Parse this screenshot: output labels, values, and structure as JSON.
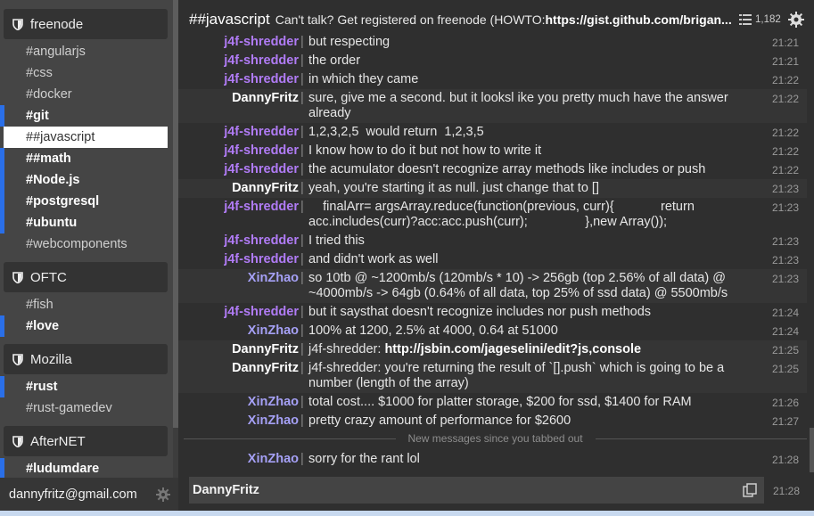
{
  "sidebar": {
    "groups": [
      {
        "network": "freenode",
        "channels": [
          {
            "name": "#angularjs",
            "unread": false,
            "active": false
          },
          {
            "name": "#css",
            "unread": false,
            "active": false
          },
          {
            "name": "#docker",
            "unread": false,
            "active": false
          },
          {
            "name": "#git",
            "unread": true,
            "active": false
          },
          {
            "name": "##javascript",
            "unread": false,
            "active": true
          },
          {
            "name": "##math",
            "unread": true,
            "active": false
          },
          {
            "name": "#Node.js",
            "unread": true,
            "active": false
          },
          {
            "name": "#postgresql",
            "unread": true,
            "active": false
          },
          {
            "name": "#ubuntu",
            "unread": true,
            "active": false
          },
          {
            "name": "#webcomponents",
            "unread": false,
            "active": false
          }
        ]
      },
      {
        "network": "OFTC",
        "channels": [
          {
            "name": "#fish",
            "unread": false,
            "active": false
          },
          {
            "name": "#love",
            "unread": true,
            "active": false
          }
        ]
      },
      {
        "network": "Mozilla",
        "channels": [
          {
            "name": "#rust",
            "unread": true,
            "active": false
          },
          {
            "name": "#rust-gamedev",
            "unread": false,
            "active": false
          }
        ]
      },
      {
        "network": "AfterNET",
        "channels": [
          {
            "name": "#ludumdare",
            "unread": true,
            "active": false
          }
        ]
      }
    ],
    "user_email": "dannyfritz@gmail.com",
    "unread_color": "#2a6fe8"
  },
  "header": {
    "channel": "##javascript",
    "topic": "Can't talk? Get registered on freenode (HOWTO: ",
    "topic_url": "https://gist.github.com/brigan...",
    "user_count": "1,182"
  },
  "messages": [
    {
      "nick": "j4f-shredder",
      "color": "purple",
      "text": "but respecting",
      "time": "21:21",
      "alt": false
    },
    {
      "nick": "j4f-shredder",
      "color": "purple",
      "text": "the order",
      "time": "21:21",
      "alt": false
    },
    {
      "nick": "j4f-shredder",
      "color": "purple",
      "text": "in which they came",
      "time": "21:22",
      "alt": false
    },
    {
      "nick": "DannyFritz",
      "color": "white",
      "text": "sure, give me a second. but it looksl ike you pretty much have the answer already",
      "time": "21:22",
      "alt": true
    },
    {
      "nick": "j4f-shredder",
      "color": "purple",
      "text": "1,2,3,2,5  would return  1,2,3,5",
      "time": "21:22",
      "alt": false
    },
    {
      "nick": "j4f-shredder",
      "color": "purple",
      "text": "I know how to do it but not how to write it",
      "time": "21:22",
      "alt": false
    },
    {
      "nick": "j4f-shredder",
      "color": "purple",
      "text": "the acumulator doesn't recognize array methods like includes or push",
      "time": "21:22",
      "alt": false
    },
    {
      "nick": "DannyFritz",
      "color": "white",
      "text": "yeah, you're starting it as null. just change that to []",
      "time": "21:23",
      "alt": true
    },
    {
      "nick": "j4f-shredder",
      "color": "purple",
      "text": "    finalArr= argsArray.reduce(function(previous, curr){             return acc.includes(curr)?acc:acc.push(curr);                },new Array());",
      "time": "21:23",
      "alt": false
    },
    {
      "nick": "j4f-shredder",
      "color": "purple",
      "text": "I tried this",
      "time": "21:23",
      "alt": false
    },
    {
      "nick": "j4f-shredder",
      "color": "purple",
      "text": "and didn't work as well",
      "time": "21:23",
      "alt": false
    },
    {
      "nick": "XinZhao",
      "color": "lav",
      "text": "so 10tb @ ~1200mb/s (120mb/s * 10) -> 256gb (top 2.56% of all data) @ ~4000mb/s -> 64gb (0.64% of all data, top 25% of ssd data) @ 5500mb/s",
      "time": "21:23",
      "alt": true
    },
    {
      "nick": "j4f-shredder",
      "color": "purple",
      "text": "but it saysthat doesn't recognize includes nor push methods",
      "time": "21:24",
      "alt": false
    },
    {
      "nick": "XinZhao",
      "color": "lav",
      "text": "100% at 1200, 2.5% at 4000, 0.64 at 51000",
      "time": "21:24",
      "alt": false
    },
    {
      "nick": "DannyFritz",
      "color": "white",
      "text": "j4f-shredder: ",
      "link": "http://jsbin.com/jageselini/edit?js,console",
      "time": "21:25",
      "alt": true
    },
    {
      "nick": "DannyFritz",
      "color": "white",
      "text": "j4f-shredder: you're returning the result of `[].push` which is going to be a number (length of the array)",
      "time": "21:25",
      "alt": true
    },
    {
      "nick": "XinZhao",
      "color": "lav",
      "text": "total cost.... $1000 for platter storage, $200 for ssd, $1400 for RAM",
      "time": "21:26",
      "alt": false
    },
    {
      "nick": "XinZhao",
      "color": "lav",
      "text": "pretty crazy amount of performance for $2600",
      "time": "21:27",
      "alt": false
    },
    {
      "nick": "XinZhao",
      "color": "lav",
      "text": "sorry for the rant lol",
      "time": "21:28",
      "alt": false
    }
  ],
  "divider_label": "New messages since you tabbed out",
  "input": {
    "nick": "DannyFritz",
    "time": "21:28"
  }
}
